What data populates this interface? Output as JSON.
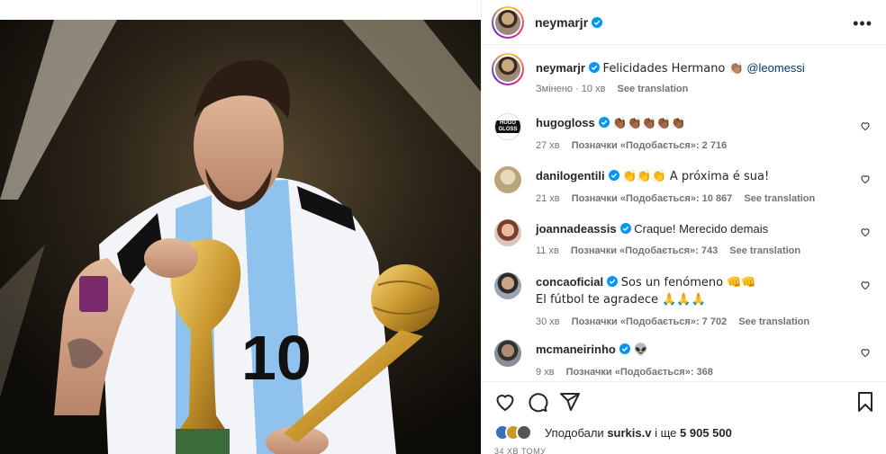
{
  "post": {
    "author": "neymarjr",
    "more_label": "•••"
  },
  "caption": {
    "user": "neymarjr",
    "text": "Felicidades Hermano 👏🏽",
    "mention": "@leomessi",
    "edited": "Змінено · 10 хв",
    "see_translation": "See translation"
  },
  "comments": [
    {
      "user": "hugogloss",
      "text": "👏🏾👏🏾👏🏾👏🏾👏🏾",
      "time": "27 хв",
      "likes": "Позначки «Подобається»: 2 716",
      "translation": "",
      "avatar_text": "HUGO GLOSS"
    },
    {
      "user": "danilogentili",
      "text": "👏👏👏 A próxima é sua!",
      "time": "21 хв",
      "likes": "Позначки «Подобається»: 10 867",
      "translation": "See translation"
    },
    {
      "user": "joannadeassis",
      "text": "Craque! Merecido demais",
      "time": "11 хв",
      "likes": "Позначки «Подобається»: 743",
      "translation": "See translation"
    },
    {
      "user": "concaoficial",
      "text": "Sos un fenómeno 👊👊",
      "text2": "El fútbol te agradece 🙏🙏🙏",
      "time": "30 хв",
      "likes": "Позначки «Подобається»: 7 702",
      "translation": "See translation"
    },
    {
      "user": "mcmaneirinho",
      "text": "👽",
      "time": "9 хв",
      "likes": "Позначки «Подобається»: 368",
      "translation": ""
    }
  ],
  "liked_by": {
    "prefix": "Уподобали",
    "user": "surkis.v",
    "suffix": "і ще",
    "count": "5 905 500"
  },
  "timestamp": "34 ХВ ТОМУ",
  "colors": {
    "verified": "#0095f6",
    "text": "#262626",
    "muted": "#737373",
    "mention": "#00376b"
  }
}
